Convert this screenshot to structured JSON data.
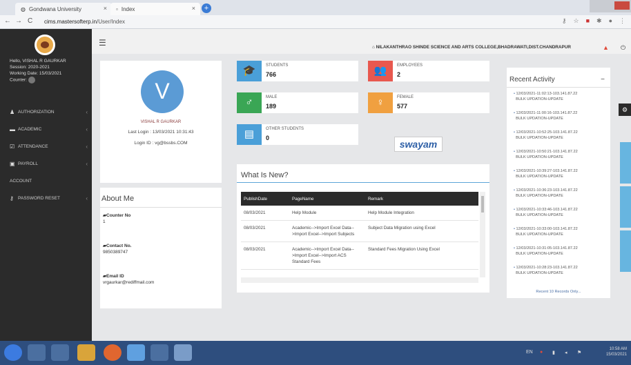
{
  "browser": {
    "tabs": [
      {
        "label": "Gondwana University"
      },
      {
        "label": "Index"
      }
    ],
    "new_tab": "+",
    "url_host": "cims.mastersofterp.in",
    "url_path": "/User/Index",
    "nav_back": "←",
    "nav_forward": "→",
    "nav_reload": "C"
  },
  "sidebar": {
    "greeting": "Hello, VISHAL R GAURKAR",
    "session": "Session: 2020-2021",
    "working_date": "Working Date: 15/03/2021",
    "counter_label": "Counter:",
    "counter_value": "1",
    "menu": [
      {
        "label": "AUTHORIZATION",
        "icon": "users-icon"
      },
      {
        "label": "ACADEMIC",
        "icon": "graduation-icon"
      },
      {
        "label": "ATTENDANCE",
        "icon": "check-icon"
      },
      {
        "label": "PAYROLL",
        "icon": "money-icon"
      },
      {
        "label": "ACCOUNT",
        "icon": ""
      },
      {
        "label": "PASSWORD RESET",
        "icon": "key-icon"
      }
    ]
  },
  "topbar": {
    "college": "NILAKANTHRAO SHINDE SCIENCE AND ARTS COLLEGE,BHADRAWATI,DIST.CHANDRAPUR"
  },
  "profile": {
    "initial": "V",
    "name": "VISHAL R GAURKAR",
    "last_login": "Last Login : 13/03/2021 10:31:43",
    "login_id": "Login ID : vg@bssbs.COM"
  },
  "about": {
    "title": "About Me",
    "counter_label": "Counter No",
    "counter_value": "1",
    "contact_label": "Contact No.",
    "contact_value": "9850389747",
    "email_label": "Email ID",
    "email_value": "vrgaurkar@rediffmail.com"
  },
  "stats": {
    "students_label": "STUDENTS",
    "students_value": "766",
    "employees_label": "EMPLOYEES",
    "employees_value": "2",
    "male_label": "MALE",
    "male_value": "189",
    "female_label": "FEMALE",
    "female_value": "577",
    "other_label": "OTHER STUDENTS",
    "other_value": "0",
    "swayam": "swayam",
    "colors": {
      "students": "#4a9fd8",
      "employees": "#e8584f",
      "male": "#3aa655",
      "female": "#f0a040",
      "other": "#4a9fd8"
    }
  },
  "news": {
    "title": "What Is New?",
    "columns": [
      "PublishDate",
      "PageName",
      "Remark"
    ],
    "rows": [
      {
        "date": "08/03/2021",
        "page": "Help Module",
        "remark": "Help Module Integration"
      },
      {
        "date": "08/03/2021",
        "page": "Academic-->Import Excel Data-->Import Excel-->Import Subjects",
        "remark": "Subject Data Migration using Excel"
      },
      {
        "date": "08/03/2021",
        "page": "Academic-->Import Excel Data-->Import Excel-->Import ACS Standard Fees",
        "remark": "Standard Fees Migration Using Excel"
      }
    ]
  },
  "recent": {
    "title": "Recent Activity",
    "items": [
      {
        "ts": "12/03/2021-11:02:13-103.141.87.22",
        "action": "BULK UPDATION-UPDATE"
      },
      {
        "ts": "12/03/2021-11:00:16-103.141.87.22",
        "action": "BULK UPDATION-UPDATE"
      },
      {
        "ts": "12/03/2021-10:52:25-103.141.87.22",
        "action": "BULK UPDATION-UPDATE"
      },
      {
        "ts": "12/03/2021-10:50:21-103.141.87.22",
        "action": "BULK UPDATION-UPDATE"
      },
      {
        "ts": "12/03/2021-10:39:27-103.141.87.22",
        "action": "BULK UPDATION-UPDATE"
      },
      {
        "ts": "12/03/2021-10:36:23-103.141.87.22",
        "action": "BULK UPDATION-UPDATE"
      },
      {
        "ts": "12/03/2021-10:33:46-103.141.87.22",
        "action": "BULK UPDATION-UPDATE"
      },
      {
        "ts": "12/03/2021-10:33:00-103.141.87.22",
        "action": "BULK UPDATION-UPDATE"
      },
      {
        "ts": "12/03/2021-10:31:05-103.141.87.22",
        "action": "BULK UPDATION-UPDATE"
      },
      {
        "ts": "12/03/2021-10:28:23-103.141.87.22",
        "action": "BULK UPDATION-UPDATE"
      }
    ],
    "more": "Recent 10 Records Only..."
  },
  "taskbar": {
    "lang": "EN",
    "time": "10:58 AM",
    "date": "15/03/2021"
  }
}
